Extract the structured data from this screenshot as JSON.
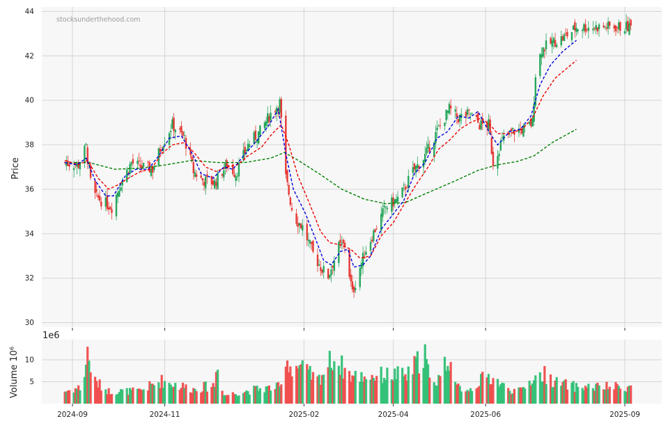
{
  "chart_data": [
    {
      "type": "candlestick",
      "title": "",
      "ylabel": "Price",
      "ylim": [
        29.8,
        44.2
      ],
      "yticks": [
        "30",
        "32",
        "34",
        "36",
        "38",
        "40",
        "42",
        "44"
      ],
      "watermark": "stocksunderthehood.com",
      "grid": true,
      "colors": {
        "up": "#26a65b",
        "down": "#e53935",
        "ma_short": "#0000dd",
        "ma_mid": "#ee0000",
        "ma_long": "#008000",
        "background": "#f7f7f7",
        "grid": "#d4d4d4"
      },
      "price_path": [
        [
          "2024-08-27",
          37.2
        ],
        [
          "2024-09-05",
          37.1
        ],
        [
          "2024-09-10",
          37.9
        ],
        [
          "2024-09-14",
          35.8
        ],
        [
          "2024-09-22",
          35.4
        ],
        [
          "2024-09-27",
          35.2
        ],
        [
          "2024-10-03",
          36.3
        ],
        [
          "2024-10-10",
          37.2
        ],
        [
          "2024-10-16",
          37.0
        ],
        [
          "2024-10-24",
          36.9
        ],
        [
          "2024-10-30",
          38.0
        ],
        [
          "2024-11-06",
          38.9
        ],
        [
          "2024-11-14",
          38.3
        ],
        [
          "2024-11-20",
          36.8
        ],
        [
          "2024-11-26",
          36.4
        ],
        [
          "2024-12-04",
          36.3
        ],
        [
          "2024-12-12",
          37.1
        ],
        [
          "2024-12-18",
          36.7
        ],
        [
          "2024-12-26",
          38.0
        ],
        [
          "2025-01-03",
          38.6
        ],
        [
          "2025-01-10",
          39.4
        ],
        [
          "2025-01-16",
          39.9
        ],
        [
          "2025-01-20",
          36.5
        ],
        [
          "2025-01-25",
          34.8
        ],
        [
          "2025-01-31",
          34.3
        ],
        [
          "2025-02-07",
          33.1
        ],
        [
          "2025-02-13",
          32.4
        ],
        [
          "2025-02-17",
          32.1
        ],
        [
          "2025-02-24",
          33.4
        ],
        [
          "2025-02-28",
          33.5
        ],
        [
          "2025-03-05",
          31.3
        ],
        [
          "2025-03-10",
          32.5
        ],
        [
          "2025-03-14",
          33.3
        ],
        [
          "2025-03-20",
          34.2
        ],
        [
          "2025-03-27",
          35.2
        ],
        [
          "2025-04-05",
          35.6
        ],
        [
          "2025-04-14",
          36.8
        ],
        [
          "2025-04-22",
          37.5
        ],
        [
          "2025-04-30",
          38.6
        ],
        [
          "2025-05-08",
          39.6
        ],
        [
          "2025-05-14",
          39.2
        ],
        [
          "2025-05-22",
          39.4
        ],
        [
          "2025-05-28",
          38.9
        ],
        [
          "2025-06-03",
          38.9
        ],
        [
          "2025-06-06",
          37.2
        ],
        [
          "2025-06-12",
          38.2
        ],
        [
          "2025-06-19",
          38.6
        ],
        [
          "2025-06-27",
          38.7
        ],
        [
          "2025-07-02",
          39.0
        ],
        [
          "2025-07-04",
          41.2
        ],
        [
          "2025-07-08",
          42.3
        ],
        [
          "2025-07-15",
          42.6
        ],
        [
          "2025-07-22",
          42.8
        ],
        [
          "2025-07-28",
          43.1
        ],
        [
          "2025-07-31",
          43.3
        ]
      ],
      "ma_short": [
        [
          "2024-08-27",
          37.2
        ],
        [
          "2024-09-04",
          37.1
        ],
        [
          "2024-09-10",
          37.4
        ],
        [
          "2024-09-16",
          36.4
        ],
        [
          "2024-09-23",
          35.7
        ],
        [
          "2024-09-28",
          35.7
        ],
        [
          "2024-10-06",
          36.6
        ],
        [
          "2024-10-13",
          36.9
        ],
        [
          "2024-10-21",
          36.9
        ],
        [
          "2024-10-28",
          37.5
        ],
        [
          "2024-11-04",
          38.3
        ],
        [
          "2024-11-12",
          38.4
        ],
        [
          "2024-11-20",
          37.5
        ],
        [
          "2024-11-25",
          36.7
        ],
        [
          "2024-12-03",
          36.5
        ],
        [
          "2024-12-10",
          37.0
        ],
        [
          "2024-12-16",
          36.9
        ],
        [
          "2024-12-23",
          37.5
        ],
        [
          "2025-01-01",
          38.2
        ],
        [
          "2025-01-09",
          38.9
        ],
        [
          "2025-01-15",
          39.6
        ],
        [
          "2025-01-20",
          37.6
        ],
        [
          "2025-01-25",
          36.0
        ],
        [
          "2025-02-02",
          34.9
        ],
        [
          "2025-02-09",
          33.7
        ],
        [
          "2025-02-14",
          32.8
        ],
        [
          "2025-02-19",
          32.6
        ],
        [
          "2025-02-25",
          33.2
        ],
        [
          "2025-03-02",
          33.3
        ],
        [
          "2025-03-06",
          32.5
        ],
        [
          "2025-03-12",
          32.6
        ],
        [
          "2025-03-17",
          33.0
        ],
        [
          "2025-03-24",
          34.2
        ],
        [
          "2025-03-31",
          34.8
        ],
        [
          "2025-04-08",
          35.5
        ],
        [
          "2025-04-15",
          36.7
        ],
        [
          "2025-04-22",
          37.2
        ],
        [
          "2025-04-30",
          38.3
        ],
        [
          "2025-05-07",
          38.6
        ],
        [
          "2025-05-14",
          39.3
        ],
        [
          "2025-05-21",
          39.2
        ],
        [
          "2025-05-27",
          39.5
        ],
        [
          "2025-06-04",
          38.5
        ],
        [
          "2025-06-09",
          38.0
        ],
        [
          "2025-06-17",
          38.6
        ],
        [
          "2025-06-24",
          38.7
        ],
        [
          "2025-07-01",
          39.3
        ],
        [
          "2025-07-07",
          40.7
        ],
        [
          "2025-07-14",
          41.6
        ],
        [
          "2025-07-22",
          42.2
        ],
        [
          "2025-07-31",
          42.7
        ]
      ],
      "ma_mid": [
        [
          "2024-08-27",
          37.3
        ],
        [
          "2024-09-05",
          37.1
        ],
        [
          "2024-09-11",
          37.3
        ],
        [
          "2024-09-18",
          36.5
        ],
        [
          "2024-09-25",
          36.0
        ],
        [
          "2024-10-01",
          36.2
        ],
        [
          "2024-10-08",
          36.5
        ],
        [
          "2024-10-16",
          36.8
        ],
        [
          "2024-10-23",
          36.9
        ],
        [
          "2024-10-30",
          37.6
        ],
        [
          "2024-11-06",
          38.0
        ],
        [
          "2024-11-14",
          38.1
        ],
        [
          "2024-11-21",
          37.6
        ],
        [
          "2024-11-28",
          37.0
        ],
        [
          "2024-12-05",
          36.8
        ],
        [
          "2024-12-12",
          37.0
        ],
        [
          "2024-12-19",
          37.1
        ],
        [
          "2024-12-26",
          37.5
        ],
        [
          "2025-01-04",
          37.9
        ],
        [
          "2025-01-11",
          38.5
        ],
        [
          "2025-01-17",
          38.9
        ],
        [
          "2025-01-22",
          38.0
        ],
        [
          "2025-01-28",
          36.6
        ],
        [
          "2025-02-05",
          35.3
        ],
        [
          "2025-02-12",
          34.1
        ],
        [
          "2025-02-18",
          33.6
        ],
        [
          "2025-02-25",
          33.5
        ],
        [
          "2025-03-04",
          33.3
        ],
        [
          "2025-03-10",
          32.9
        ],
        [
          "2025-03-17",
          33.0
        ],
        [
          "2025-03-24",
          33.9
        ],
        [
          "2025-04-01",
          34.5
        ],
        [
          "2025-04-08",
          35.3
        ],
        [
          "2025-04-16",
          36.2
        ],
        [
          "2025-04-24",
          37.0
        ],
        [
          "2025-05-01",
          37.8
        ],
        [
          "2025-05-08",
          38.2
        ],
        [
          "2025-05-15",
          38.7
        ],
        [
          "2025-05-22",
          39.0
        ],
        [
          "2025-05-29",
          39.2
        ],
        [
          "2025-06-04",
          38.9
        ],
        [
          "2025-06-09",
          38.5
        ],
        [
          "2025-06-17",
          38.5
        ],
        [
          "2025-06-25",
          38.7
        ],
        [
          "2025-07-02",
          39.2
        ],
        [
          "2025-07-09",
          40.2
        ],
        [
          "2025-07-17",
          41.0
        ],
        [
          "2025-07-24",
          41.4
        ],
        [
          "2025-07-31",
          41.8
        ]
      ],
      "ma_long": [
        [
          "2024-08-27",
          37.2
        ],
        [
          "2024-09-12",
          37.2
        ],
        [
          "2024-09-29",
          36.9
        ],
        [
          "2024-10-16",
          36.95
        ],
        [
          "2024-11-02",
          37.1
        ],
        [
          "2024-11-19",
          37.3
        ],
        [
          "2024-12-06",
          37.2
        ],
        [
          "2024-12-24",
          37.2
        ],
        [
          "2025-01-10",
          37.4
        ],
        [
          "2025-01-19",
          37.65
        ],
        [
          "2025-01-27",
          37.35
        ],
        [
          "2025-02-11",
          36.7
        ],
        [
          "2025-02-26",
          36.0
        ],
        [
          "2025-03-13",
          35.55
        ],
        [
          "2025-03-27",
          35.35
        ],
        [
          "2025-04-09",
          35.4
        ],
        [
          "2025-04-24",
          35.85
        ],
        [
          "2025-05-11",
          36.35
        ],
        [
          "2025-05-27",
          36.85
        ],
        [
          "2025-06-09",
          37.1
        ],
        [
          "2025-06-22",
          37.25
        ],
        [
          "2025-07-03",
          37.5
        ],
        [
          "2025-07-15",
          38.1
        ],
        [
          "2025-07-31",
          38.7
        ]
      ]
    },
    {
      "type": "bar",
      "ylabel": "Volume  10⁶",
      "scale_label": "1e6",
      "ylim": [
        0,
        14.6
      ],
      "yticks": [
        "5",
        "10"
      ],
      "xticks": [
        "2024-09",
        "2024-11",
        "2025-02",
        "2025-04",
        "2025-06",
        "2025-09"
      ],
      "volume_path": [
        [
          "2024-08-27",
          3.0
        ],
        [
          "2024-09-08",
          4.0
        ],
        [
          "2024-09-11",
          12.5
        ],
        [
          "2024-09-15",
          5.5
        ],
        [
          "2024-09-25",
          3.0
        ],
        [
          "2024-10-15",
          3.0
        ],
        [
          "2024-10-30",
          5.5
        ],
        [
          "2024-11-20",
          3.5
        ],
        [
          "2024-12-04",
          4.5
        ],
        [
          "2024-12-06",
          10.5
        ],
        [
          "2024-12-10",
          2.0
        ],
        [
          "2025-01-01",
          3.5
        ],
        [
          "2025-01-17",
          4.0
        ],
        [
          "2025-01-19",
          8.0
        ],
        [
          "2025-01-20",
          12.5
        ],
        [
          "2025-01-22",
          9.0
        ],
        [
          "2025-01-29",
          9.0
        ],
        [
          "2025-02-10",
          5.5
        ],
        [
          "2025-02-20",
          11.0
        ],
        [
          "2025-03-05",
          6.5
        ],
        [
          "2025-04-05",
          7.0
        ],
        [
          "2025-04-10",
          6.5
        ],
        [
          "2025-04-22",
          12.5
        ],
        [
          "2025-04-26",
          3.0
        ],
        [
          "2025-05-08",
          11.5
        ],
        [
          "2025-05-12",
          4.0
        ],
        [
          "2025-05-22",
          3.5
        ],
        [
          "2025-06-01",
          6.5
        ],
        [
          "2025-06-07",
          6.0
        ],
        [
          "2025-06-15",
          3.5
        ],
        [
          "2025-06-24",
          3.0
        ],
        [
          "2025-07-02",
          6.0
        ],
        [
          "2025-07-10",
          7.0
        ],
        [
          "2025-07-18",
          5.0
        ],
        [
          "2025-07-31",
          4.0
        ]
      ]
    }
  ]
}
